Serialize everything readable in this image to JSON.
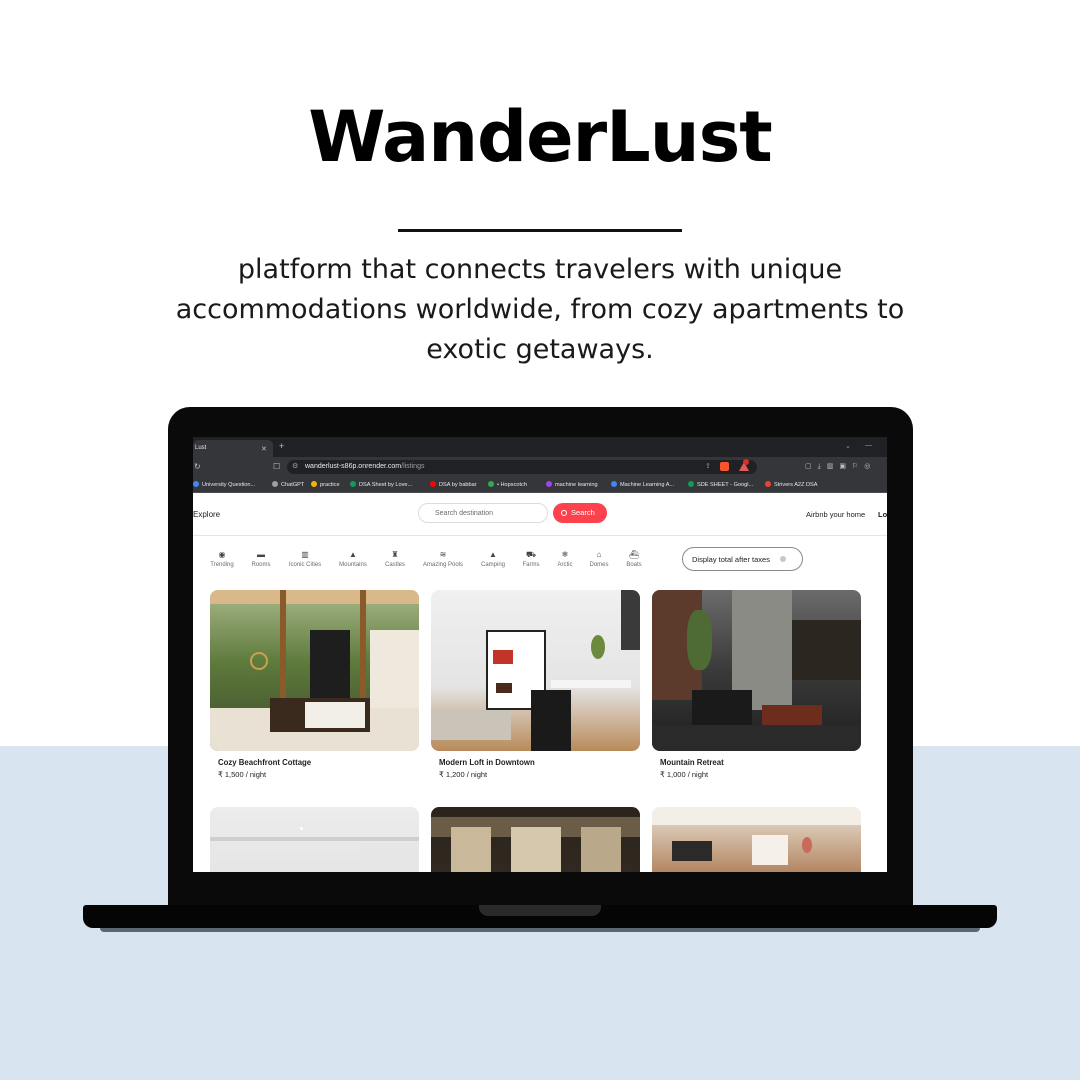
{
  "hero": {
    "title": "WanderLust",
    "subtitle": "platform that connects travelers with unique accommodations worldwide, from cozy apartments to exotic getaways."
  },
  "browser": {
    "tab_title": "Lust",
    "url_host": "wanderlust-s86p.onrender.com",
    "url_path": "/listings",
    "bookmarks": [
      {
        "label": "University Question...",
        "color": "#4285f4"
      },
      {
        "label": "ChatGPT",
        "color": "#9aa0a6"
      },
      {
        "label": "practice",
        "color": "#f4b400"
      },
      {
        "label": "DSA Sheet by Love...",
        "color": "#0f9d58"
      },
      {
        "label": "DSA by babbar",
        "color": "#ff0000"
      },
      {
        "label": "• Hopscotch",
        "color": "#34a853"
      },
      {
        "label": "machine learning",
        "color": "#a142f4"
      },
      {
        "label": "Machine Learning A...",
        "color": "#4285f4"
      },
      {
        "label": "SDE SHEET - Googl...",
        "color": "#0f9d58"
      },
      {
        "label": "Strivers A2Z DSA",
        "color": "#ea4335"
      }
    ]
  },
  "site": {
    "nav": {
      "explore": "Explore",
      "search_placeholder": "Search destination",
      "search_button": "Search",
      "host_link": "Airbnb your home",
      "login": "Lo"
    },
    "filters": [
      {
        "label": "Trending",
        "icon": "fire-icon"
      },
      {
        "label": "Rooms",
        "icon": "bed-icon"
      },
      {
        "label": "Iconic Cities",
        "icon": "city-icon"
      },
      {
        "label": "Mountains",
        "icon": "mountain-icon"
      },
      {
        "label": "Castles",
        "icon": "castle-icon"
      },
      {
        "label": "Amazing Pools",
        "icon": "pool-icon"
      },
      {
        "label": "Camping",
        "icon": "tent-icon"
      },
      {
        "label": "Farms",
        "icon": "tractor-icon"
      },
      {
        "label": "Arctic",
        "icon": "snowflake-icon"
      },
      {
        "label": "Domes",
        "icon": "igloo-icon"
      },
      {
        "label": "Boats",
        "icon": "ferry-icon"
      }
    ],
    "tax_toggle": "Display total after taxes",
    "listings": [
      {
        "title": "Cozy Beachfront Cottage",
        "price": "₹ 1,500 / night"
      },
      {
        "title": "Modern Loft in Downtown",
        "price": "₹ 1,200 / night"
      },
      {
        "title": "Mountain Retreat",
        "price": "₹ 1,000 / night"
      },
      {
        "title": "",
        "price": ""
      },
      {
        "title": "",
        "price": ""
      },
      {
        "title": "",
        "price": ""
      }
    ]
  }
}
